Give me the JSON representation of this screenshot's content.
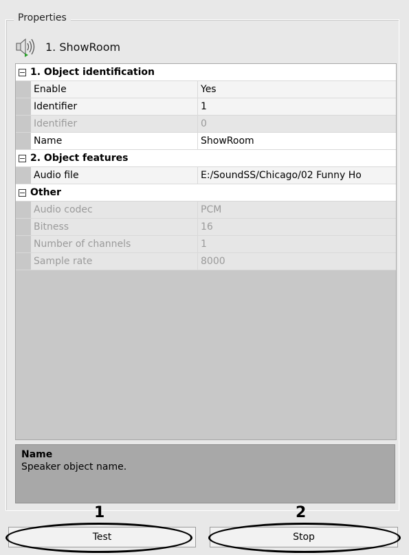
{
  "group_title": "Properties",
  "object": {
    "name": "1. ShowRoom",
    "icon": "speaker-icon"
  },
  "categories": [
    {
      "title": "1. Object identification",
      "rows": [
        {
          "name": "Enable",
          "value": "Yes"
        },
        {
          "name": "Identifier",
          "value": "1"
        },
        {
          "name": "Identifier",
          "value": "0"
        },
        {
          "name": "Name",
          "value": "ShowRoom"
        }
      ]
    },
    {
      "title": "2. Object features",
      "rows": [
        {
          "name": "Audio file",
          "value": "E:/SoundSS/Chicago/02 Funny Ho"
        }
      ]
    },
    {
      "title": "Other",
      "rows": [
        {
          "name": "Audio codec",
          "value": "PCM"
        },
        {
          "name": "Bitness",
          "value": "16"
        },
        {
          "name": "Number of channels",
          "value": "1"
        },
        {
          "name": "Sample rate",
          "value": "8000"
        }
      ]
    }
  ],
  "description": {
    "title": "Name",
    "text": "Speaker object name."
  },
  "buttons": {
    "test": "Test",
    "stop": "Stop"
  },
  "callouts": {
    "one": "1",
    "two": "2"
  }
}
